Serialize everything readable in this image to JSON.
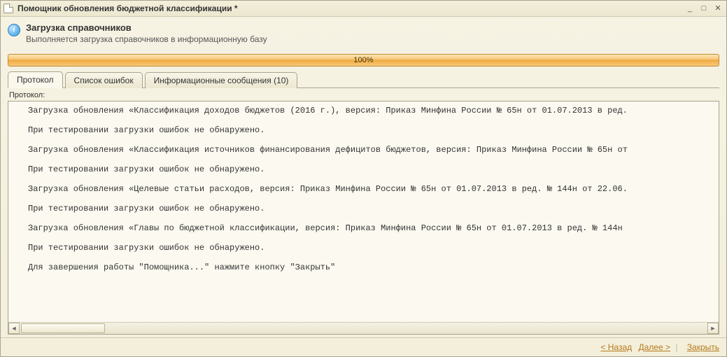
{
  "window": {
    "title": "Помощник обновления бюджетной классификации *"
  },
  "header": {
    "title": "Загрузка справочников",
    "subtitle": "Выполняется загрузка справочников в информационную базу"
  },
  "progress": {
    "label": "100%"
  },
  "tabs": [
    {
      "id": "protocol",
      "label": "Протокол",
      "active": true
    },
    {
      "id": "errors",
      "label": "Список ошибок",
      "active": false
    },
    {
      "id": "info",
      "label": "Информационные сообщения (10)",
      "active": false
    }
  ],
  "logLabel": "Протокол:",
  "logLines": [
    "Загрузка обновления «Классификация доходов бюджетов (2016 г.), версия: Приказ Минфина России № 65н от 01.07.2013 в ред.",
    "При тестировании загрузки ошибок не обнаружено.",
    "Загрузка обновления «Классификация источников финансирования дефицитов бюджетов, версия: Приказ Минфина России № 65н от",
    "При тестировании загрузки ошибок не обнаружено.",
    "Загрузка обновления «Целевые статьи расходов, версия: Приказ Минфина России № 65н от 01.07.2013 в ред. № 144н от 22.06.",
    "При тестировании загрузки ошибок не обнаружено.",
    "Загрузка обновления «Главы по бюджетной классификации, версия: Приказ Минфина России № 65н от 01.07.2013 в ред. № 144н",
    "При тестировании загрузки ошибок не обнаружено.",
    "Для завершения работы \"Помощника...\" нажмите кнопку \"Закрыть\""
  ],
  "footer": {
    "back": "< Назад",
    "next": "Далее >",
    "close": "Закрыть"
  },
  "icons": {
    "info": "i",
    "min": "_",
    "max": "□",
    "close": "✕",
    "left": "◄",
    "right": "►"
  }
}
